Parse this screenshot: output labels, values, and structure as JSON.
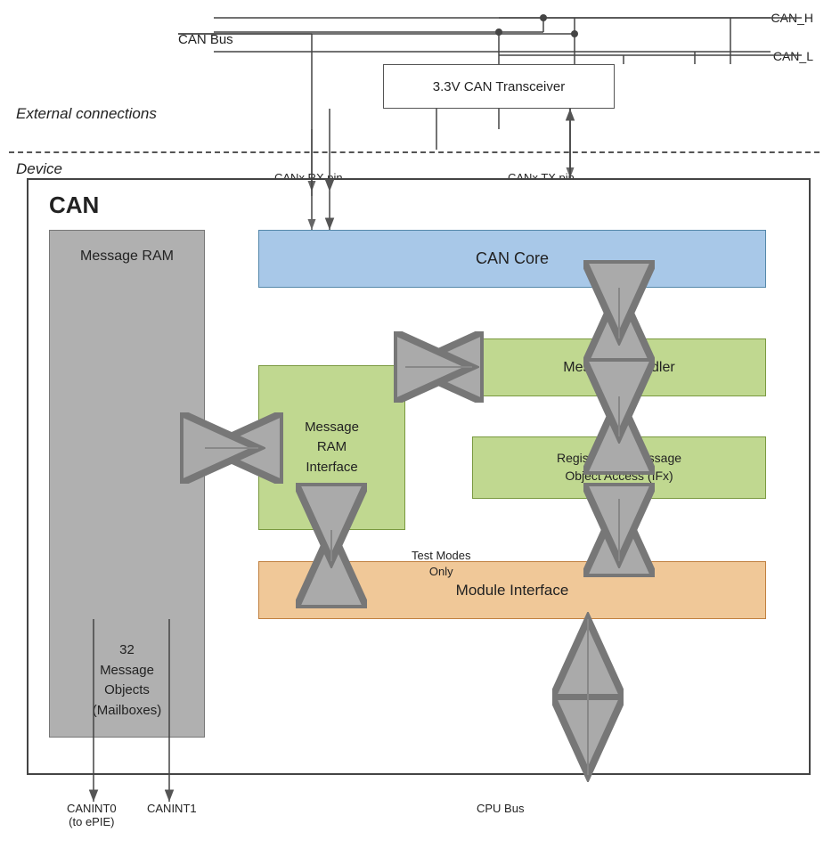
{
  "labels": {
    "external_connections": "External connections",
    "device": "Device",
    "can_bus": "CAN Bus",
    "can_h": "CAN_H",
    "can_l": "CAN_L",
    "transceiver": "3.3V CAN Transceiver",
    "can_title": "CAN",
    "message_ram_top": "Message RAM",
    "message_ram_bottom": "32\nMessage\nObjects\n(Mailboxes)",
    "can_core": "CAN Core",
    "msg_ram_interface": "Message\nRAM\nInterface",
    "msg_handler": "Message Handler",
    "reg_msg_obj": "Register and Message\nObject Access (IFx)",
    "module_interface": "Module Interface",
    "canx_rx": "CANx RX pin",
    "canx_tx": "CANx TX pin",
    "test_modes": "Test Modes\nOnly",
    "canint0": "CANINT0\n(to ePIE)",
    "canint1": "CANINT1",
    "cpu_bus": "CPU Bus"
  }
}
